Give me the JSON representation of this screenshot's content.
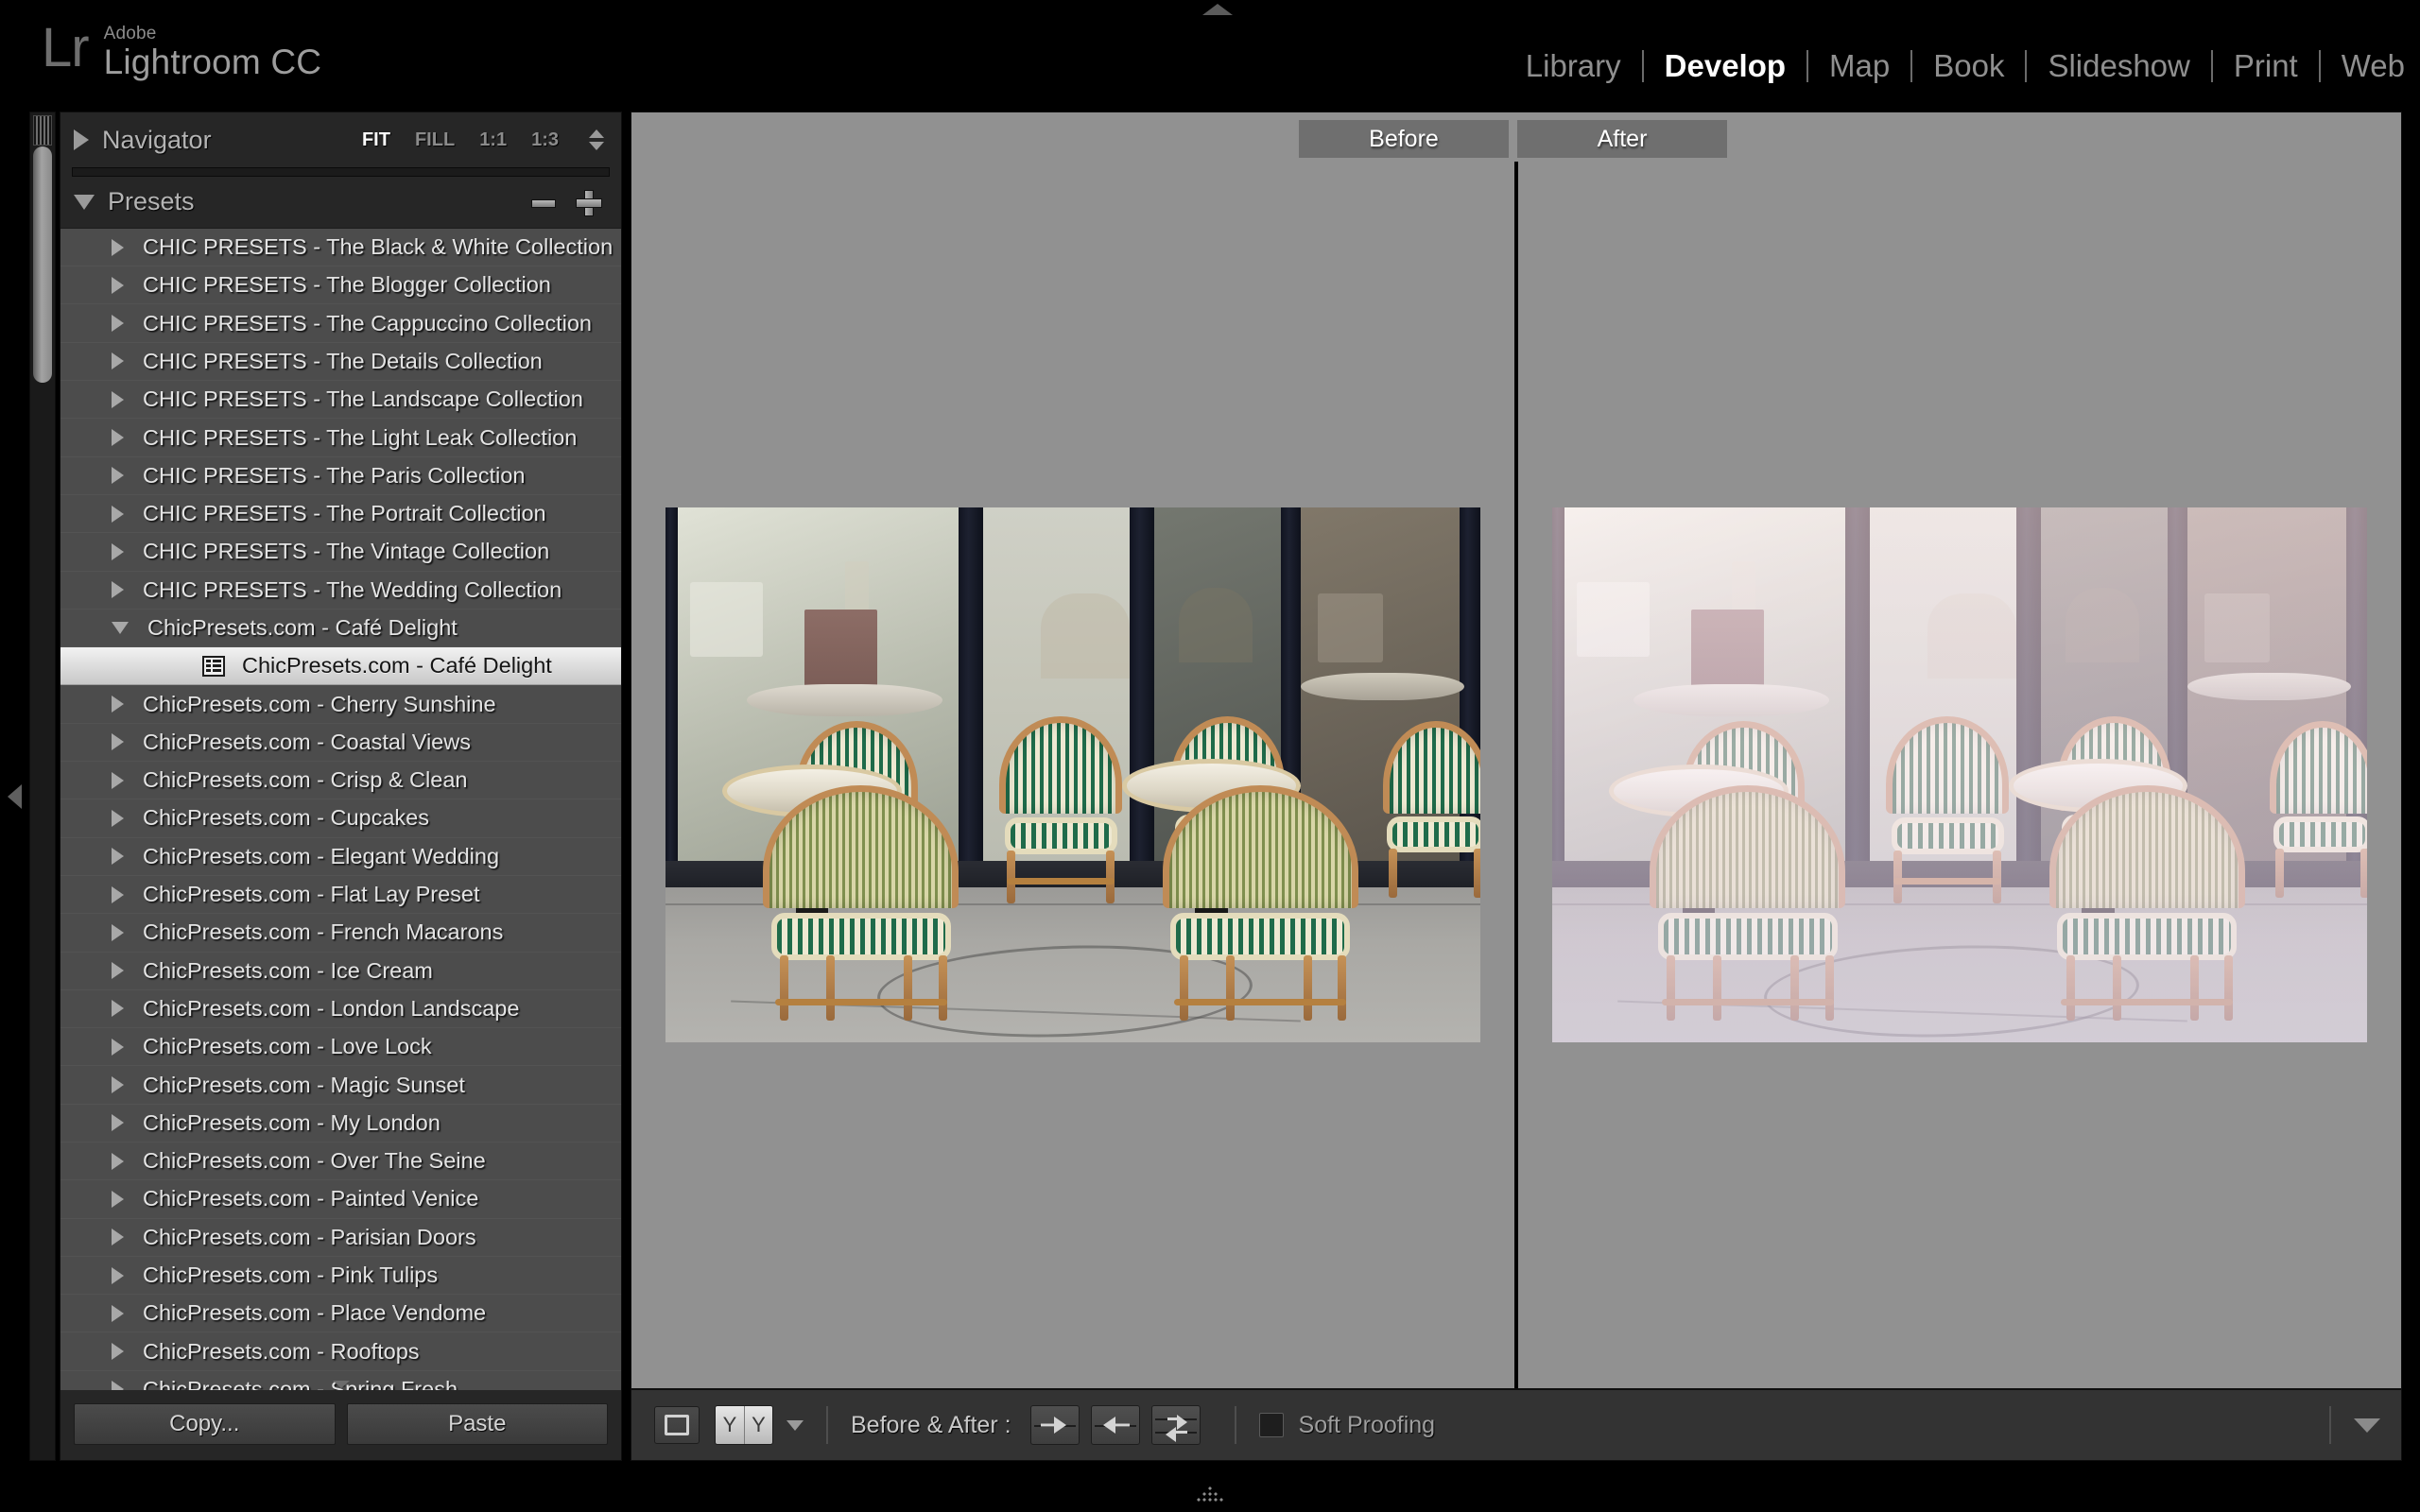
{
  "app": {
    "brand_mark": "Lr",
    "brand_vendor": "Adobe",
    "brand_product": "Lightroom CC"
  },
  "modules": [
    {
      "label": "Library",
      "active": false
    },
    {
      "label": "Develop",
      "active": true
    },
    {
      "label": "Map",
      "active": false
    },
    {
      "label": "Book",
      "active": false
    },
    {
      "label": "Slideshow",
      "active": false
    },
    {
      "label": "Print",
      "active": false
    },
    {
      "label": "Web",
      "active": false
    }
  ],
  "navigator": {
    "title": "Navigator",
    "zoom_steps": [
      {
        "label": "FIT",
        "active": true
      },
      {
        "label": "FILL",
        "active": false
      },
      {
        "label": "1:1",
        "active": false
      },
      {
        "label": "1:3",
        "active": false
      }
    ]
  },
  "presets_panel": {
    "title": "Presets",
    "remove_label": "−",
    "add_label": "+",
    "items": [
      {
        "label": "CHIC PRESETS - The Black & White Collection",
        "expanded": false,
        "selected": false,
        "child": false
      },
      {
        "label": "CHIC PRESETS - The Blogger Collection",
        "expanded": false,
        "selected": false,
        "child": false
      },
      {
        "label": "CHIC PRESETS - The Cappuccino Collection",
        "expanded": false,
        "selected": false,
        "child": false
      },
      {
        "label": "CHIC PRESETS - The Details Collection",
        "expanded": false,
        "selected": false,
        "child": false
      },
      {
        "label": "CHIC PRESETS - The Landscape Collection",
        "expanded": false,
        "selected": false,
        "child": false
      },
      {
        "label": "CHIC PRESETS - The Light Leak Collection",
        "expanded": false,
        "selected": false,
        "child": false
      },
      {
        "label": "CHIC PRESETS - The Paris Collection",
        "expanded": false,
        "selected": false,
        "child": false
      },
      {
        "label": "CHIC PRESETS - The Portrait Collection",
        "expanded": false,
        "selected": false,
        "child": false
      },
      {
        "label": "CHIC PRESETS - The Vintage Collection",
        "expanded": false,
        "selected": false,
        "child": false
      },
      {
        "label": "CHIC PRESETS - The Wedding Collection",
        "expanded": false,
        "selected": false,
        "child": false
      },
      {
        "label": "ChicPresets.com - Café Delight",
        "expanded": true,
        "selected": false,
        "child": false
      },
      {
        "label": "ChicPresets.com - Café Delight",
        "expanded": false,
        "selected": true,
        "child": true
      },
      {
        "label": "ChicPresets.com - Cherry Sunshine",
        "expanded": false,
        "selected": false,
        "child": false
      },
      {
        "label": "ChicPresets.com - Coastal Views",
        "expanded": false,
        "selected": false,
        "child": false
      },
      {
        "label": "ChicPresets.com - Crisp & Clean",
        "expanded": false,
        "selected": false,
        "child": false
      },
      {
        "label": "ChicPresets.com - Cupcakes",
        "expanded": false,
        "selected": false,
        "child": false
      },
      {
        "label": "ChicPresets.com - Elegant Wedding",
        "expanded": false,
        "selected": false,
        "child": false
      },
      {
        "label": "ChicPresets.com - Flat Lay Preset",
        "expanded": false,
        "selected": false,
        "child": false
      },
      {
        "label": "ChicPresets.com - French Macarons",
        "expanded": false,
        "selected": false,
        "child": false
      },
      {
        "label": "ChicPresets.com - Ice Cream",
        "expanded": false,
        "selected": false,
        "child": false
      },
      {
        "label": "ChicPresets.com - London Landscape",
        "expanded": false,
        "selected": false,
        "child": false
      },
      {
        "label": "ChicPresets.com - Love Lock",
        "expanded": false,
        "selected": false,
        "child": false
      },
      {
        "label": "ChicPresets.com - Magic Sunset",
        "expanded": false,
        "selected": false,
        "child": false
      },
      {
        "label": "ChicPresets.com - My London",
        "expanded": false,
        "selected": false,
        "child": false
      },
      {
        "label": "ChicPresets.com - Over The Seine",
        "expanded": false,
        "selected": false,
        "child": false
      },
      {
        "label": "ChicPresets.com - Painted Venice",
        "expanded": false,
        "selected": false,
        "child": false
      },
      {
        "label": "ChicPresets.com - Parisian Doors",
        "expanded": false,
        "selected": false,
        "child": false
      },
      {
        "label": "ChicPresets.com - Pink Tulips",
        "expanded": false,
        "selected": false,
        "child": false
      },
      {
        "label": "ChicPresets.com - Place Vendome",
        "expanded": false,
        "selected": false,
        "child": false
      },
      {
        "label": "ChicPresets.com - Rooftops",
        "expanded": false,
        "selected": false,
        "child": false
      },
      {
        "label": "ChicPresets.com - Spring Fresh",
        "expanded": false,
        "selected": false,
        "child": false
      }
    ]
  },
  "left_footer": {
    "copy_label": "Copy...",
    "paste_label": "Paste"
  },
  "preview": {
    "before_label": "Before",
    "after_label": "After",
    "subject": "Parisian cafe terrace with green and cream striped rattan bistro chairs and marble tables",
    "backdrop_color": "#919191"
  },
  "toolbar": {
    "loupe_view_label": "",
    "compare_view_label": "Y",
    "before_after_label": "Before & After :",
    "soft_proofing_label": "Soft Proofing",
    "soft_proofing_checked": false
  }
}
